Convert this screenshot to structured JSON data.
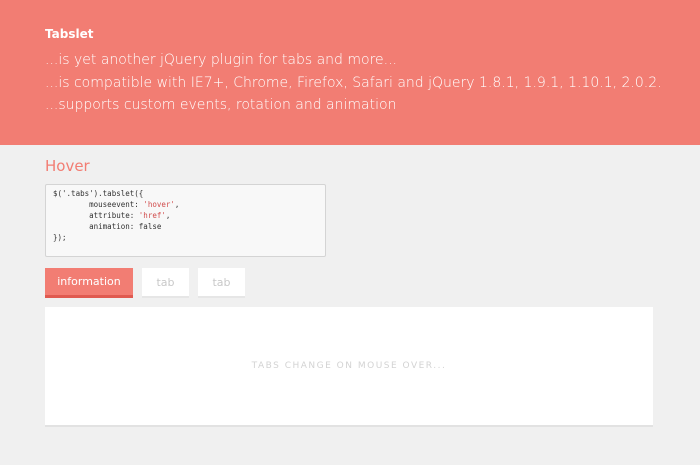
{
  "header": {
    "title": "Tabslet",
    "lines": [
      "...is yet another jQuery plugin for tabs and more...",
      "...is compatible with IE7+, Chrome, Firefox, Safari and jQuery 1.8.1, 1.9.1, 1.10.1, 2.0.2.",
      "...supports custom events, rotation and animation"
    ]
  },
  "section": {
    "title": "Hover"
  },
  "code": {
    "line1": "$('.tabs').tabslet({",
    "mouseevent_key": "        mouseevent: ",
    "mouseevent_val": "'hover'",
    "attribute_key": "        attribute: ",
    "attribute_val": "'href'",
    "animation_line": "        animation: false",
    "line_end": "});"
  },
  "tabs": [
    {
      "label": "information",
      "active": true
    },
    {
      "label": "tab",
      "active": false
    },
    {
      "label": "tab",
      "active": false
    }
  ],
  "panel": {
    "text": "TABS CHANGE ON MOUSE OVER..."
  },
  "colors": {
    "accent": "#f27d73",
    "background": "#f0f0f0",
    "code_string": "#d14c4c"
  }
}
